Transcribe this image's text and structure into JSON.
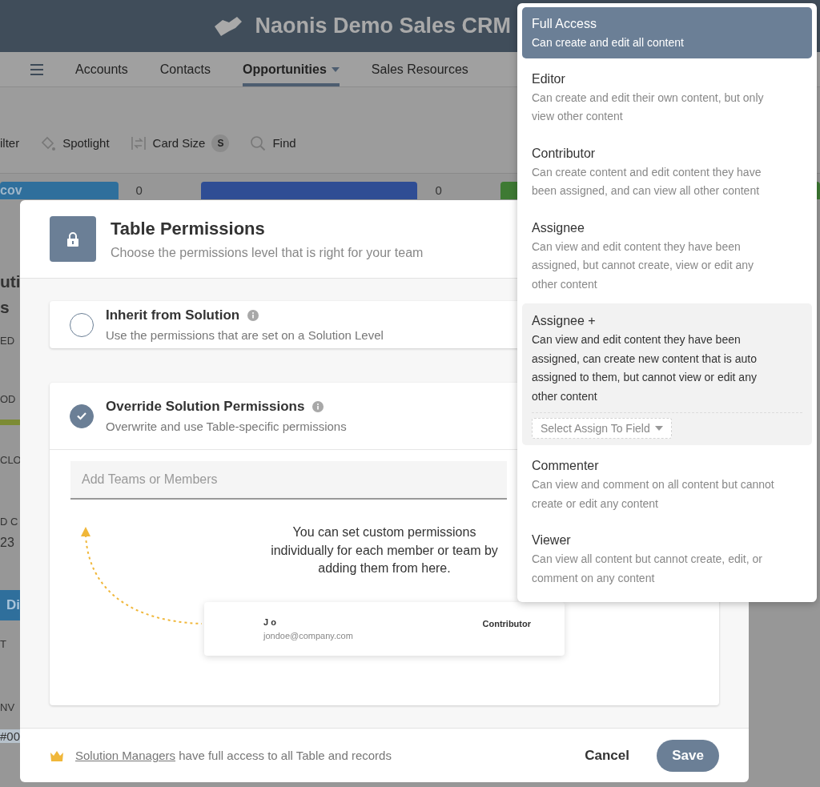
{
  "app": {
    "title": "Naonis Demo Sales CRM",
    "nav": [
      {
        "label": "Accounts",
        "selected": false,
        "dropdown": false
      },
      {
        "label": "Contacts",
        "selected": false,
        "dropdown": false
      },
      {
        "label": "Opportunities",
        "selected": true,
        "dropdown": true
      },
      {
        "label": "Sales Resources",
        "selected": false,
        "dropdown": false
      }
    ],
    "toolbar": [
      {
        "kind": "filter",
        "label": "ilter"
      },
      {
        "kind": "spotlight",
        "label": "Spotlight"
      },
      {
        "kind": "size",
        "label": "Card Size",
        "badge": "S"
      },
      {
        "kind": "find",
        "label": "Find"
      }
    ],
    "board_columns": [
      {
        "label": "cov",
        "count": "0",
        "color": "#2f6f9c"
      },
      {
        "count": "0",
        "color": "#2f4d94"
      },
      {
        "color": "#3e7a33"
      }
    ],
    "fragments": [
      {
        "kind": "heading",
        "text": "uti"
      },
      {
        "kind": "heading",
        "text": "s"
      },
      {
        "kind": "label",
        "text": "ED"
      },
      {
        "kind": "label",
        "text": "OD"
      },
      {
        "kind": "bar"
      },
      {
        "kind": "label",
        "text": "CLO"
      },
      {
        "kind": "label",
        "text": "D C"
      },
      {
        "kind": "value",
        "text": "23"
      },
      {
        "kind": "band",
        "text": "Di"
      },
      {
        "kind": "label",
        "text": "T"
      },
      {
        "kind": "label",
        "text": "NV"
      },
      {
        "kind": "tag",
        "text": "#00"
      }
    ]
  },
  "dialog": {
    "title": "Table Permissions",
    "subtitle": "Choose the permissions level that is right for your team",
    "options": [
      {
        "title": "Inherit from Solution",
        "description": "Use the permissions that are set on a Solution Level",
        "selected": false
      },
      {
        "title": "Override Solution Permissions",
        "description": "Overwrite and use Table-specific permissions",
        "selected": true,
        "panel": {
          "placeholder": "Add Teams or Members",
          "hint": "You can set custom permissions individually for each member or team by adding them from here.",
          "sample_member": {
            "name": "J o",
            "email": "jondoe@company.com",
            "role": "Contributor"
          }
        }
      }
    ],
    "footer": {
      "link": "Solution Managers",
      "note": "have full access to all Table and records",
      "cancel": "Cancel",
      "save": "Save"
    }
  },
  "role_menu": [
    {
      "title": "Full Access",
      "description": "Can create and edit all content",
      "selected": true,
      "highlighted": false
    },
    {
      "title": "Editor",
      "description": "Can create and edit their own content, but only view other content",
      "selected": false,
      "highlighted": false
    },
    {
      "title": "Contributor",
      "description": "Can create content and edit content they have been assigned, and can view all other content",
      "selected": false,
      "highlighted": false
    },
    {
      "title": "Assignee",
      "description": "Can view and edit content they have been assigned, but cannot create, view or edit any other content",
      "selected": false,
      "highlighted": false
    },
    {
      "title": "Assignee +",
      "description": "Can view and edit content they have been assigned, can create new content that is auto assigned to them, but cannot view or edit any other content",
      "selected": false,
      "highlighted": true,
      "field": "Select Assign To Field"
    },
    {
      "title": "Commenter",
      "description": "Can view and comment on all content but cannot create or edit any content",
      "selected": false,
      "highlighted": false
    },
    {
      "title": "Viewer",
      "description": "Can view all content but cannot create, edit, or comment on any content",
      "selected": false,
      "highlighted": false
    }
  ]
}
